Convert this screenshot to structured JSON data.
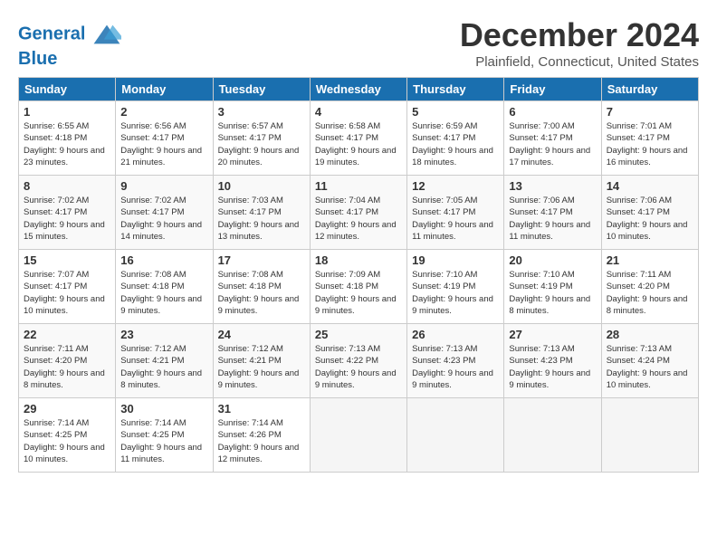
{
  "header": {
    "logo_line1": "General",
    "logo_line2": "Blue",
    "month_title": "December 2024",
    "location": "Plainfield, Connecticut, United States"
  },
  "weekdays": [
    "Sunday",
    "Monday",
    "Tuesday",
    "Wednesday",
    "Thursday",
    "Friday",
    "Saturday"
  ],
  "weeks": [
    [
      {
        "day": "1",
        "sunrise": "6:55 AM",
        "sunset": "4:18 PM",
        "daylight": "9 hours and 23 minutes."
      },
      {
        "day": "2",
        "sunrise": "6:56 AM",
        "sunset": "4:17 PM",
        "daylight": "9 hours and 21 minutes."
      },
      {
        "day": "3",
        "sunrise": "6:57 AM",
        "sunset": "4:17 PM",
        "daylight": "9 hours and 20 minutes."
      },
      {
        "day": "4",
        "sunrise": "6:58 AM",
        "sunset": "4:17 PM",
        "daylight": "9 hours and 19 minutes."
      },
      {
        "day": "5",
        "sunrise": "6:59 AM",
        "sunset": "4:17 PM",
        "daylight": "9 hours and 18 minutes."
      },
      {
        "day": "6",
        "sunrise": "7:00 AM",
        "sunset": "4:17 PM",
        "daylight": "9 hours and 17 minutes."
      },
      {
        "day": "7",
        "sunrise": "7:01 AM",
        "sunset": "4:17 PM",
        "daylight": "9 hours and 16 minutes."
      }
    ],
    [
      {
        "day": "8",
        "sunrise": "7:02 AM",
        "sunset": "4:17 PM",
        "daylight": "9 hours and 15 minutes."
      },
      {
        "day": "9",
        "sunrise": "7:02 AM",
        "sunset": "4:17 PM",
        "daylight": "9 hours and 14 minutes."
      },
      {
        "day": "10",
        "sunrise": "7:03 AM",
        "sunset": "4:17 PM",
        "daylight": "9 hours and 13 minutes."
      },
      {
        "day": "11",
        "sunrise": "7:04 AM",
        "sunset": "4:17 PM",
        "daylight": "9 hours and 12 minutes."
      },
      {
        "day": "12",
        "sunrise": "7:05 AM",
        "sunset": "4:17 PM",
        "daylight": "9 hours and 11 minutes."
      },
      {
        "day": "13",
        "sunrise": "7:06 AM",
        "sunset": "4:17 PM",
        "daylight": "9 hours and 11 minutes."
      },
      {
        "day": "14",
        "sunrise": "7:06 AM",
        "sunset": "4:17 PM",
        "daylight": "9 hours and 10 minutes."
      }
    ],
    [
      {
        "day": "15",
        "sunrise": "7:07 AM",
        "sunset": "4:17 PM",
        "daylight": "9 hours and 10 minutes."
      },
      {
        "day": "16",
        "sunrise": "7:08 AM",
        "sunset": "4:18 PM",
        "daylight": "9 hours and 9 minutes."
      },
      {
        "day": "17",
        "sunrise": "7:08 AM",
        "sunset": "4:18 PM",
        "daylight": "9 hours and 9 minutes."
      },
      {
        "day": "18",
        "sunrise": "7:09 AM",
        "sunset": "4:18 PM",
        "daylight": "9 hours and 9 minutes."
      },
      {
        "day": "19",
        "sunrise": "7:10 AM",
        "sunset": "4:19 PM",
        "daylight": "9 hours and 9 minutes."
      },
      {
        "day": "20",
        "sunrise": "7:10 AM",
        "sunset": "4:19 PM",
        "daylight": "9 hours and 8 minutes."
      },
      {
        "day": "21",
        "sunrise": "7:11 AM",
        "sunset": "4:20 PM",
        "daylight": "9 hours and 8 minutes."
      }
    ],
    [
      {
        "day": "22",
        "sunrise": "7:11 AM",
        "sunset": "4:20 PM",
        "daylight": "9 hours and 8 minutes."
      },
      {
        "day": "23",
        "sunrise": "7:12 AM",
        "sunset": "4:21 PM",
        "daylight": "9 hours and 8 minutes."
      },
      {
        "day": "24",
        "sunrise": "7:12 AM",
        "sunset": "4:21 PM",
        "daylight": "9 hours and 9 minutes."
      },
      {
        "day": "25",
        "sunrise": "7:13 AM",
        "sunset": "4:22 PM",
        "daylight": "9 hours and 9 minutes."
      },
      {
        "day": "26",
        "sunrise": "7:13 AM",
        "sunset": "4:23 PM",
        "daylight": "9 hours and 9 minutes."
      },
      {
        "day": "27",
        "sunrise": "7:13 AM",
        "sunset": "4:23 PM",
        "daylight": "9 hours and 9 minutes."
      },
      {
        "day": "28",
        "sunrise": "7:13 AM",
        "sunset": "4:24 PM",
        "daylight": "9 hours and 10 minutes."
      }
    ],
    [
      {
        "day": "29",
        "sunrise": "7:14 AM",
        "sunset": "4:25 PM",
        "daylight": "9 hours and 10 minutes."
      },
      {
        "day": "30",
        "sunrise": "7:14 AM",
        "sunset": "4:25 PM",
        "daylight": "9 hours and 11 minutes."
      },
      {
        "day": "31",
        "sunrise": "7:14 AM",
        "sunset": "4:26 PM",
        "daylight": "9 hours and 12 minutes."
      },
      null,
      null,
      null,
      null
    ]
  ]
}
